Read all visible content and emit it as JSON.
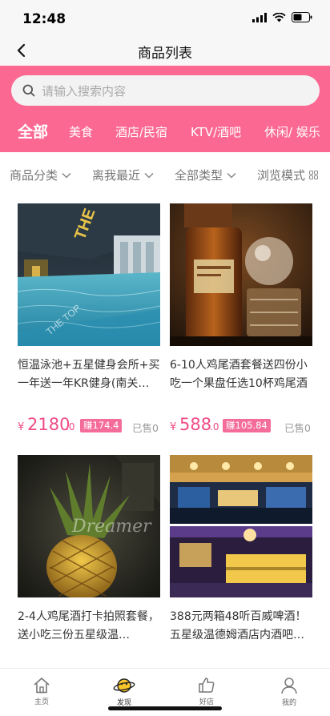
{
  "status": {
    "time": "12:48"
  },
  "nav": {
    "title": "商品列表"
  },
  "search": {
    "placeholder": "请输入搜索内容"
  },
  "categories": [
    {
      "label": "全部"
    },
    {
      "label": "美食"
    },
    {
      "label": "酒店/民宿"
    },
    {
      "label": "KTV/酒吧"
    },
    {
      "label": "休闲/ 娱乐"
    }
  ],
  "filters": [
    {
      "label": "商品分类"
    },
    {
      "label": "离我最近"
    },
    {
      "label": "全部类型"
    },
    {
      "label": "浏览模式"
    }
  ],
  "products": [
    {
      "title": "恒温泳池+五星健身会所+买一年送一年KR健身(南关亚…",
      "price_symbol": "¥",
      "price_int": "2180",
      "price_dec": ".0",
      "earn": "赚174.4",
      "sold": "已售0"
    },
    {
      "title": "6-10人鸡尾酒套餐送四份小吃一个果盘任选10杯鸡尾酒",
      "price_symbol": "¥",
      "price_int": "588",
      "price_dec": ".0",
      "earn": "赚105.84",
      "sold": "已售0"
    },
    {
      "title": "2-4人鸡尾酒打卡拍照套餐，送小吃三份五星级温…",
      "image_text": "Dreamer"
    },
    {
      "title": "388元两箱48听百威啤酒！五星级温德姆酒店内酒吧…"
    }
  ],
  "tabbar": [
    {
      "label": "主页",
      "icon": "home-icon"
    },
    {
      "label": "发现",
      "icon": "planet-icon"
    },
    {
      "label": "好店",
      "icon": "thumb-up-icon"
    },
    {
      "label": "我的",
      "icon": "person-icon"
    }
  ],
  "colors": {
    "accent": "#fb6993",
    "price": "#f04b86",
    "badge": "#f46d9a"
  }
}
